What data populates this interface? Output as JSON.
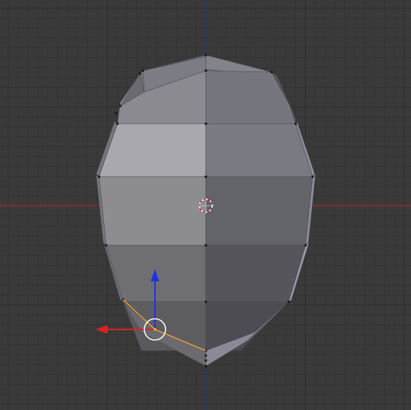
{
  "viewport": {
    "mode": "edit-mode",
    "view": "front-orthographic",
    "object": "head-mesh"
  },
  "colors": {
    "background": "#3a3a3a",
    "grid_minor": "#333333",
    "grid_major": "#2c2c2c",
    "axis_x": "#c62b2b",
    "axis_z": "#2432b8",
    "selection": "#f5a623",
    "vertex": "#000000",
    "manipulator_x": "#e02020",
    "manipulator_z": "#2030e0",
    "manipulator_ring": "#ffffff",
    "cursor_ring_a": "#ffffff",
    "cursor_ring_b": "#d02020"
  },
  "icons": [
    "3d-cursor-icon",
    "translate-manipulator-icon",
    "vertex-icon"
  ]
}
